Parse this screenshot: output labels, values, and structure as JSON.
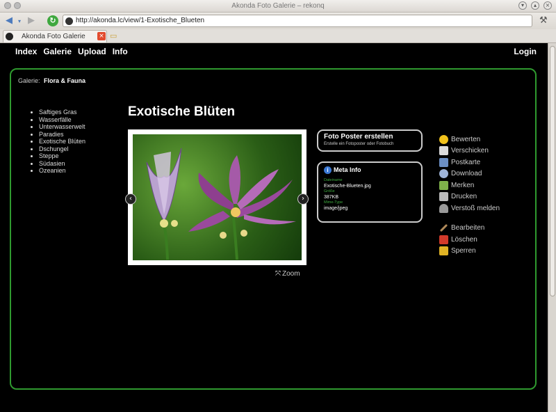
{
  "window": {
    "title": "Akonda Foto Galerie – rekonq"
  },
  "browser": {
    "url": "http://akonda.lc/view/1-Exotische_Blueten",
    "tab_label": "Akonda Foto Galerie",
    "tab_close_glyph": "×"
  },
  "nav": {
    "items": [
      "Index",
      "Galerie",
      "Upload",
      "Info"
    ],
    "login": "Login"
  },
  "breadcrumb": {
    "label": "Galerie:",
    "current": "Flora & Fauna"
  },
  "categories": [
    "Saftiges Gras",
    "Wasserfälle",
    "Unterwasserwelt",
    "Paradies",
    "Exotische Blüten",
    "Dschungel",
    "Steppe",
    "Südasien",
    "Ozeanien"
  ],
  "photo": {
    "title": "Exotische Blüten",
    "zoom_label": "Zoom"
  },
  "poster": {
    "title": "Foto Poster erstellen",
    "subtitle": "Erstelle ein Fotoposter oder Fotobuch"
  },
  "meta": {
    "heading": "Meta Info",
    "fields": [
      {
        "label": "Dateiname",
        "value": "Exotische-Blueten.jpg"
      },
      {
        "label": "Größe",
        "value": "387KB"
      },
      {
        "label": "Mime-Type",
        "value": "image/jpeg"
      }
    ]
  },
  "actions": [
    {
      "label": "Bewerten",
      "icon": "star-icon",
      "color": "#f2c21b"
    },
    {
      "label": "Verschicken",
      "icon": "mail-icon",
      "color": "#dcdcdc"
    },
    {
      "label": "Postkarte",
      "icon": "postcard-icon",
      "color": "#6b8fc4"
    },
    {
      "label": "Download",
      "icon": "download-icon",
      "color": "#9fb4d8"
    },
    {
      "label": "Merken",
      "icon": "bookmark-icon",
      "color": "#7fb24a"
    },
    {
      "label": "Drucken",
      "icon": "printer-icon",
      "color": "#bbbbbb"
    },
    {
      "label": "Verstoß melden",
      "icon": "report-icon",
      "color": "#999999"
    }
  ],
  "admin_actions": [
    {
      "label": "Bearbeiten",
      "icon": "edit-icon",
      "color": "#b08a5a"
    },
    {
      "label": "Löschen",
      "icon": "delete-icon",
      "color": "#d23a2a"
    },
    {
      "label": "Sperren",
      "icon": "lock-icon",
      "color": "#e0b325"
    }
  ]
}
